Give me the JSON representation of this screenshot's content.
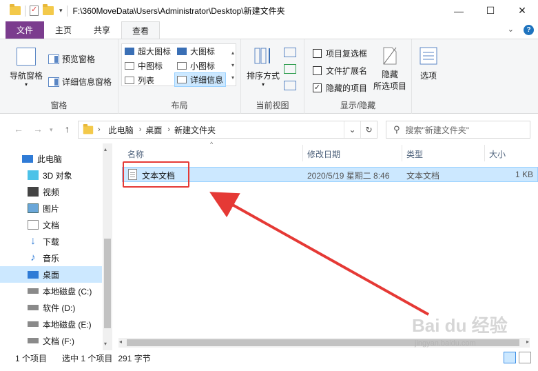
{
  "window": {
    "path": "F:\\360MoveData\\Users\\Administrator\\Desktop\\新建文件夹",
    "controls": [
      "—",
      "☐",
      "✕"
    ]
  },
  "tabs": [
    "文件",
    "主页",
    "共享",
    "查看"
  ],
  "ribbon": {
    "panes": {
      "label": "窗格",
      "nav_pane": "导航窗格",
      "preview_pane": "预览窗格",
      "details_pane": "详细信息窗格"
    },
    "layout": {
      "label": "布局",
      "items": [
        "超大图标",
        "大图标",
        "中图标",
        "小图标",
        "列表",
        "详细信息"
      ]
    },
    "current_view": {
      "label": "当前视图",
      "sort_by": "排序方式"
    },
    "show_hide": {
      "label": "显示/隐藏",
      "item_checkboxes": "项目复选框",
      "file_extensions": "文件扩展名",
      "hidden_items": "隐藏的项目",
      "hide_selected_line1": "隐藏",
      "hide_selected_line2": "所选项目",
      "options": "选项"
    }
  },
  "address": {
    "crumbs": [
      "此电脑",
      "桌面",
      "新建文件夹"
    ],
    "search_placeholder": "搜索\"新建文件夹\""
  },
  "nav_items": [
    "此电脑",
    "3D 对象",
    "视频",
    "图片",
    "文档",
    "下载",
    "音乐",
    "桌面",
    "本地磁盘 (C:)",
    "软件 (D:)",
    "本地磁盘 (E:)",
    "文档 (F:)"
  ],
  "columns": [
    "名称",
    "修改日期",
    "类型",
    "大小"
  ],
  "files": [
    {
      "name": "文本文档",
      "modified": "2020/5/19 星期二 8:46",
      "type": "文本文档",
      "size": "1 KB"
    }
  ],
  "status": {
    "count": "1 个项目",
    "selected": "选中 1 个项目",
    "size": "291 字节"
  },
  "watermark": {
    "brand": "Bai du 经验",
    "url": "jingyan.baidu.com"
  },
  "colors": {
    "file_tab": "#7b3c8e",
    "selection": "#cce8ff",
    "annotation_red": "#e53935"
  }
}
